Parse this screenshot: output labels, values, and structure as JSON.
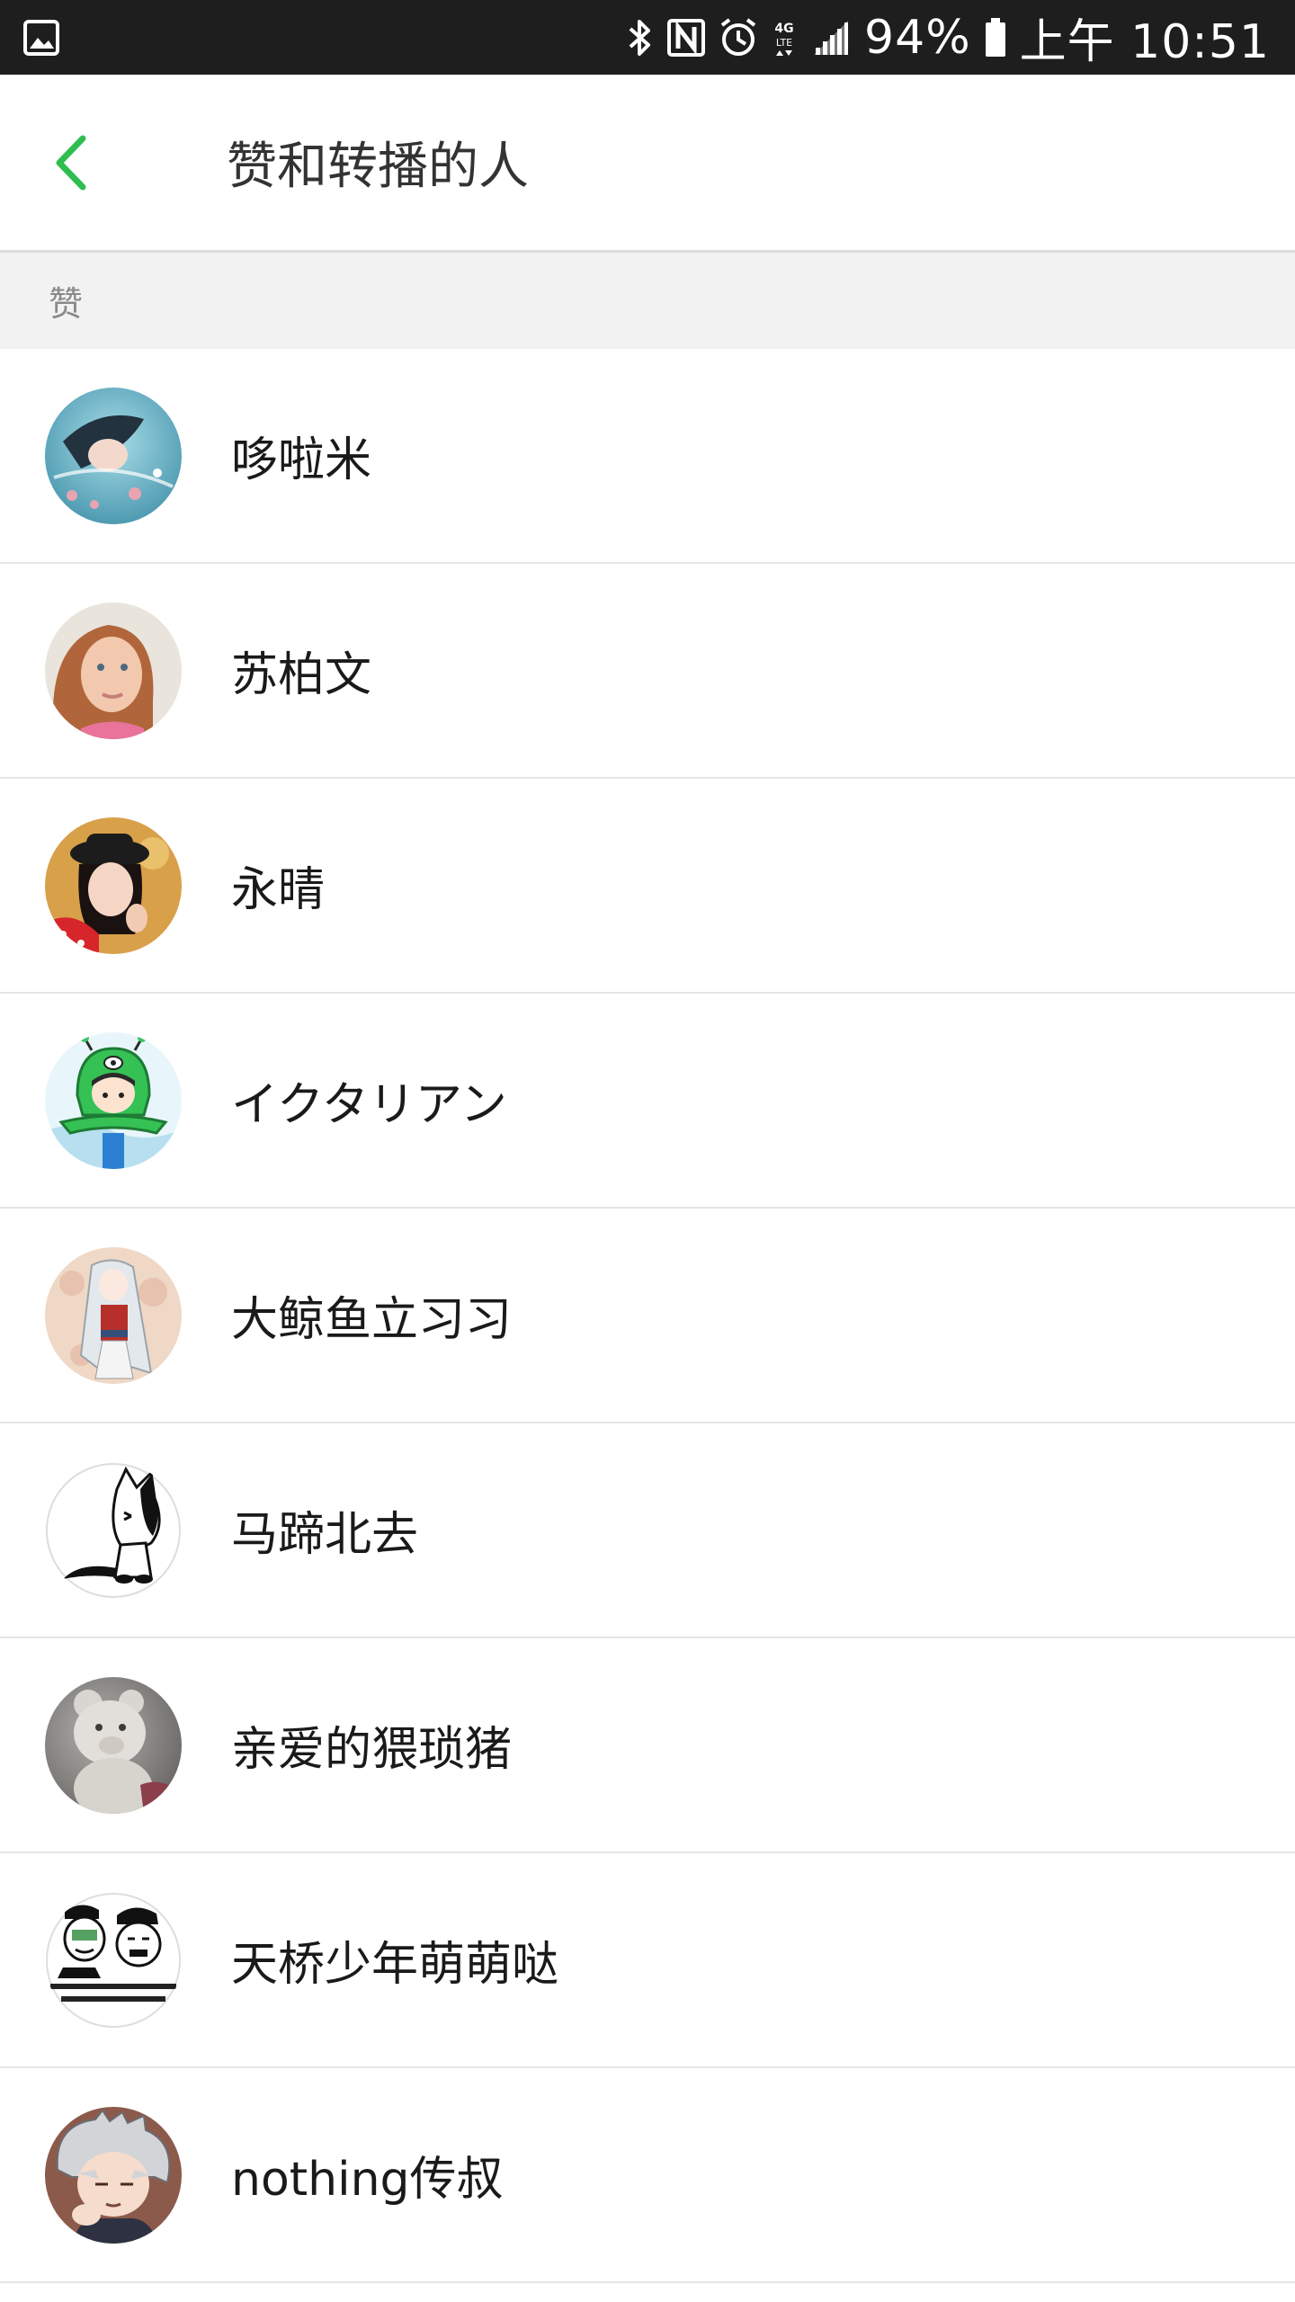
{
  "status_bar": {
    "battery": "94%",
    "time": "上午 10:51",
    "network": "4G LTE",
    "icons": [
      "gallery-icon",
      "bluetooth-icon",
      "nfc-icon",
      "alarm-icon",
      "network-4g-icon",
      "signal-icon",
      "battery-icon"
    ]
  },
  "header": {
    "title": "赞和转播的人",
    "back_icon": "chevron-left-icon",
    "accent_color": "#2dbe4f"
  },
  "section": {
    "label": "赞"
  },
  "users": [
    {
      "name": "哆啦米",
      "avatar": "anime-girl-swimming-avatar"
    },
    {
      "name": "苏柏文",
      "avatar": "girl-photo-avatar"
    },
    {
      "name": "永晴",
      "avatar": "woman-hat-photo-avatar"
    },
    {
      "name": "イクタリアン",
      "avatar": "green-alien-cartoon-avatar"
    },
    {
      "name": "大鲸鱼立习习",
      "avatar": "anime-white-hair-avatar"
    },
    {
      "name": "马蹄北去",
      "avatar": "cartoon-cat-avatar"
    },
    {
      "name": "亲爱的猥琐猪",
      "avatar": "teddy-bear-avatar"
    },
    {
      "name": "天桥少年萌萌哒",
      "avatar": "meme-comic-avatar"
    },
    {
      "name": "nothing传叔",
      "avatar": "anime-silver-hair-avatar"
    }
  ]
}
